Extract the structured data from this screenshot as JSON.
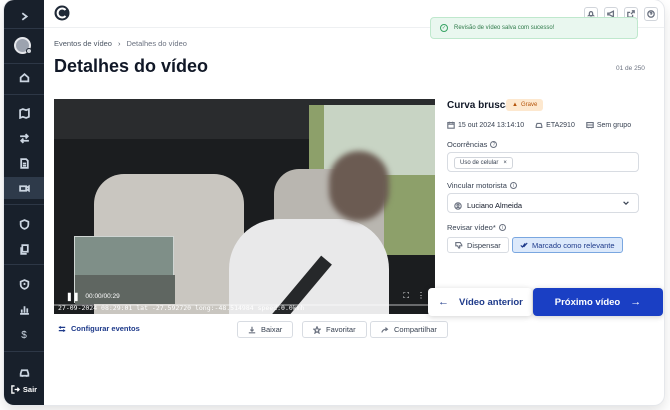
{
  "toast": {
    "message": "Revisão de vídeo salva com sucesso!"
  },
  "sidebar": {
    "logout_label": "Sair"
  },
  "breadcrumb": {
    "parent": "Eventos de vídeo",
    "current": "Detalhes do vídeo"
  },
  "page": {
    "title": "Detalhes do vídeo",
    "counter": "01 de 250"
  },
  "video": {
    "time": "00:00/00:29",
    "overlay": "27-09-2024 08:29:01 lat -27.592720 long:-48.514984 speed:0.0kmh"
  },
  "video_actions": {
    "configure": "Configurar eventos",
    "download": "Baixar",
    "favorite": "Favoritar",
    "share": "Compartilhar"
  },
  "event": {
    "title": "Curva brusca",
    "severity": "Grave",
    "datetime": "15 out 2024 13:14:10",
    "vehicle": "ETA2910",
    "group": "Sem grupo"
  },
  "occurrences": {
    "label": "Ocorrências",
    "chips": [
      "Uso de celular"
    ]
  },
  "driver": {
    "label": "Vincular motorista",
    "value": "Luciano Almeida"
  },
  "review": {
    "label": "Revisar vídeo*",
    "dismiss": "Dispensar",
    "relevant": "Marcado como relevante"
  },
  "nav": {
    "prev": "Vídeo anterior",
    "next": "Próximo vídeo"
  },
  "colors": {
    "primary": "#1a3fc4",
    "sidebar": "#18202b",
    "toast_bg": "#e9f7ef",
    "severity_bg": "#fde8cf"
  }
}
